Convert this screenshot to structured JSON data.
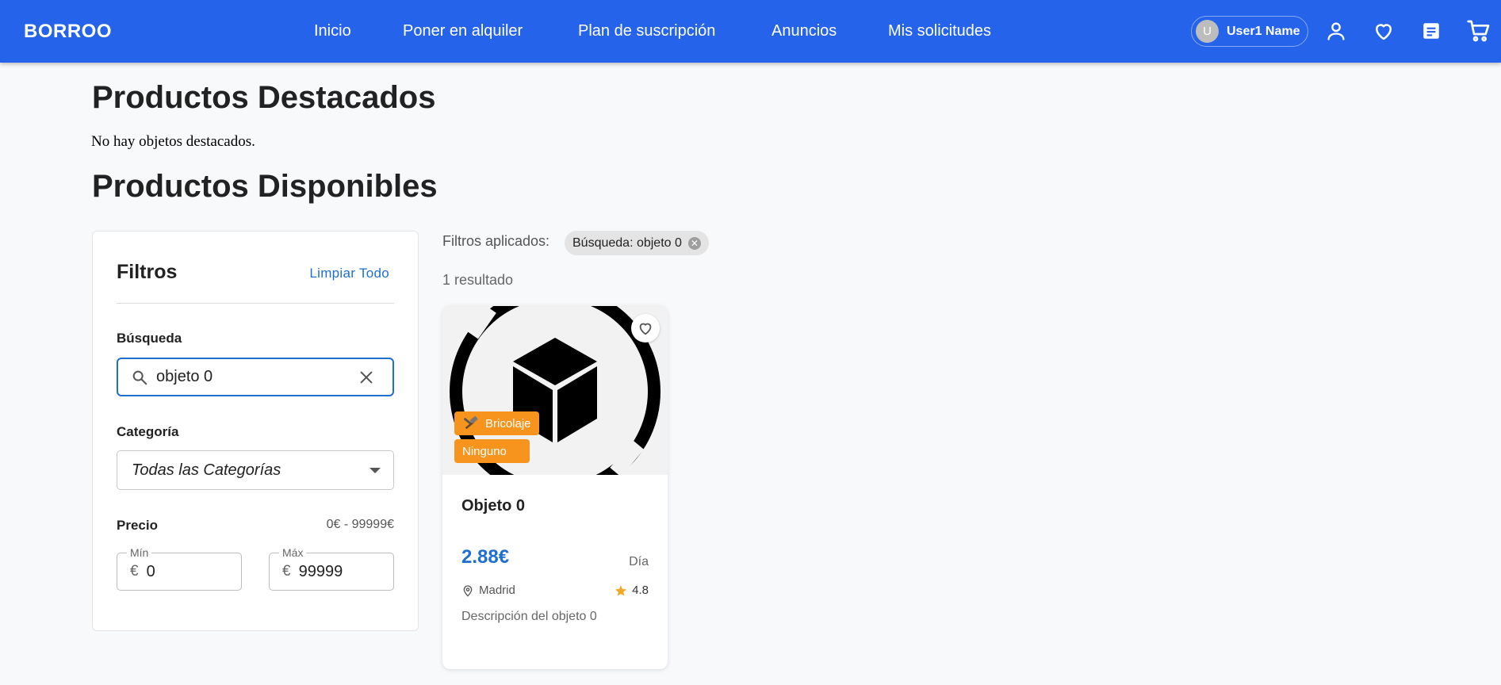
{
  "header": {
    "brand": "BORROO",
    "nav": [
      "Inicio",
      "Poner en alquiler",
      "Plan de suscripción",
      "Anuncios",
      "Mis solicitudes"
    ],
    "user": {
      "initial": "U",
      "name": "User1 Name"
    },
    "icons": [
      "user-icon",
      "heart-icon",
      "document-icon",
      "cart-icon"
    ],
    "accent_color": "#2563eb"
  },
  "featured": {
    "heading": "Productos Destacados",
    "empty_message": "No hay objetos destacados."
  },
  "available": {
    "heading": "Productos Disponibles"
  },
  "filters": {
    "title": "Filtros",
    "clear_all": "Limpiar Todo",
    "search": {
      "label": "Búsqueda",
      "value": "objeto 0"
    },
    "category": {
      "label": "Categoría",
      "value": "Todas las Categorías"
    },
    "price": {
      "label": "Precio",
      "range_text": "0€ - 99999€",
      "min": {
        "legend": "Mín",
        "currency": "€",
        "value": "0"
      },
      "max": {
        "legend": "Máx",
        "currency": "€",
        "value": "99999"
      }
    }
  },
  "applied": {
    "label": "Filtros aplicados:",
    "chips": [
      {
        "text": "Búsqueda: objeto 0"
      }
    ]
  },
  "results": {
    "count_text": "1 resultado",
    "products": [
      {
        "title": "Objeto 0",
        "category_tag": "Bricolaje",
        "condition_tag": "Ninguno",
        "price": "2.88€",
        "unit": "Día",
        "location": "Madrid",
        "rating": "4.8",
        "description": "Descripción del objeto 0"
      }
    ]
  }
}
